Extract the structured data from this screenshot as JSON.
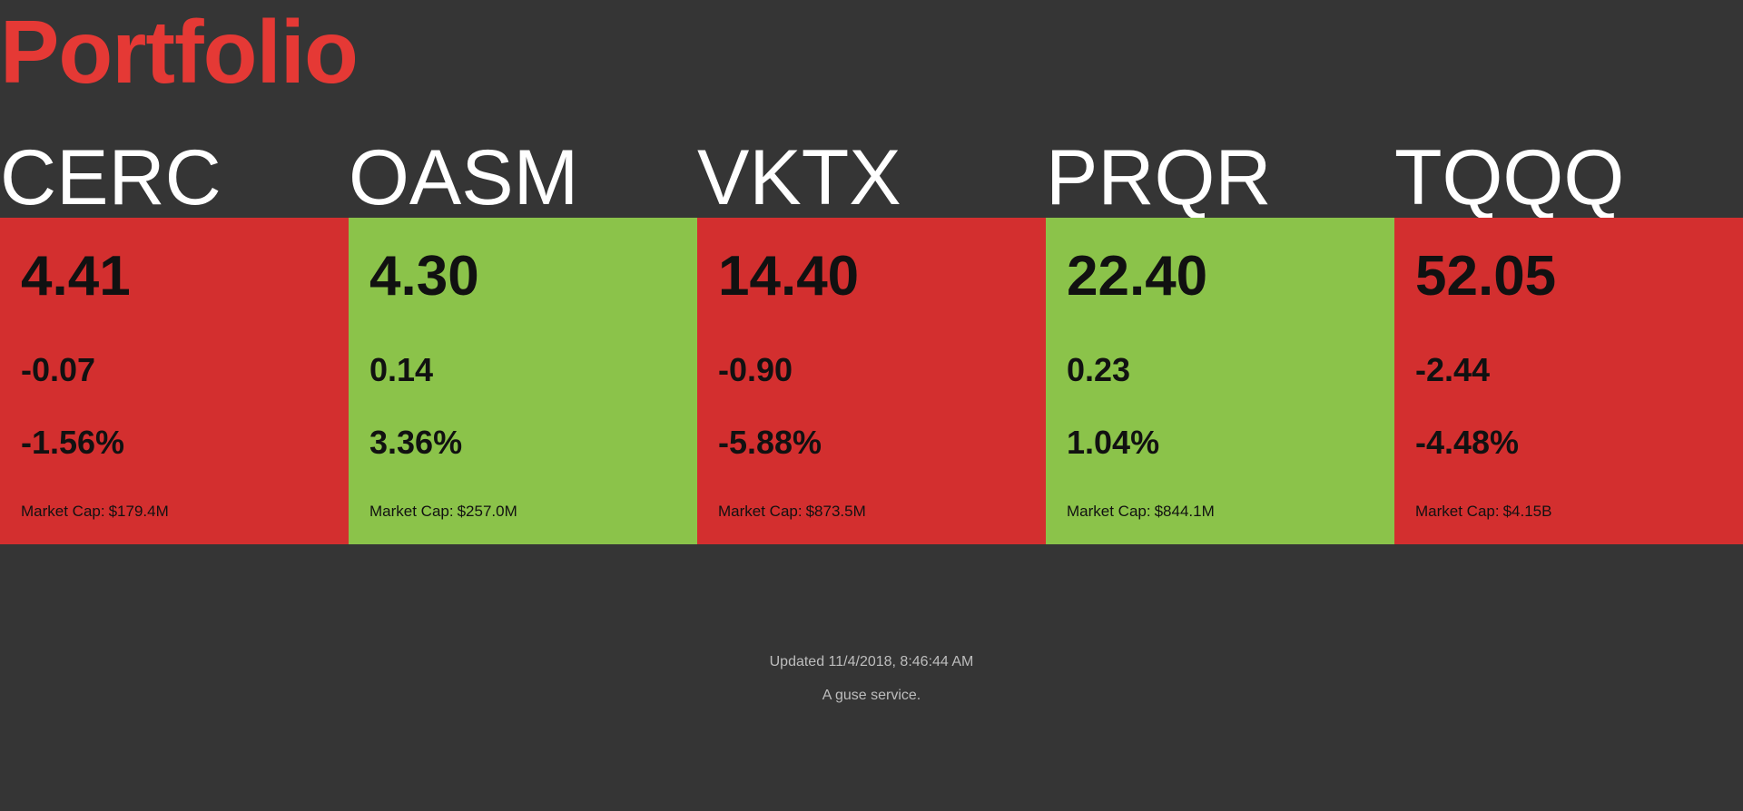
{
  "page": {
    "title": "Portfolio"
  },
  "colors": {
    "background": "#353535",
    "title": "#e53935",
    "down": "#d32f2f",
    "up": "#8bc34a",
    "footer_text": "#bdbdbd"
  },
  "market_cap_label": "Market Cap:",
  "stocks": [
    {
      "symbol": "CERC",
      "price": "4.41",
      "change": "-0.07",
      "change_percent": "-1.56%",
      "market_cap": "$179.4M",
      "direction": "down"
    },
    {
      "symbol": "OASM",
      "price": "4.30",
      "change": "0.14",
      "change_percent": "3.36%",
      "market_cap": "$257.0M",
      "direction": "up"
    },
    {
      "symbol": "VKTX",
      "price": "14.40",
      "change": "-0.90",
      "change_percent": "-5.88%",
      "market_cap": "$873.5M",
      "direction": "down"
    },
    {
      "symbol": "PRQR",
      "price": "22.40",
      "change": "0.23",
      "change_percent": "1.04%",
      "market_cap": "$844.1M",
      "direction": "up"
    },
    {
      "symbol": "TQQQ",
      "price": "52.05",
      "change": "-2.44",
      "change_percent": "-4.48%",
      "market_cap": "$4.15B",
      "direction": "down"
    }
  ],
  "footer": {
    "updated": "Updated 11/4/2018, 8:46:44 AM",
    "service": "A guse service."
  }
}
